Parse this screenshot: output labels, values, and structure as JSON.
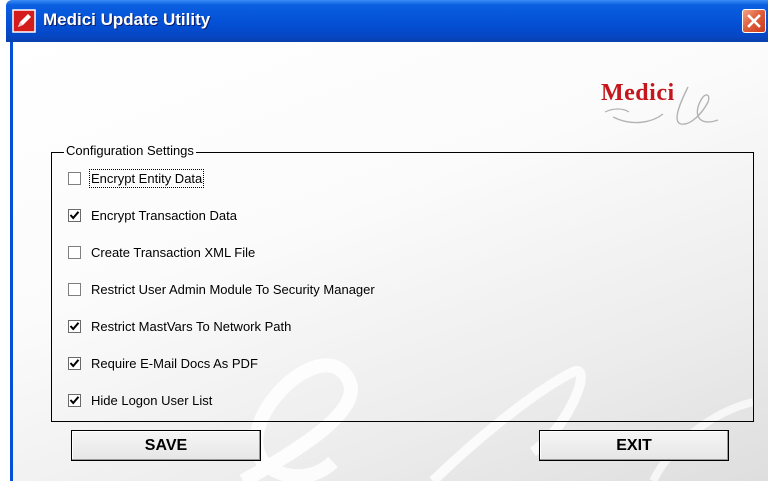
{
  "window": {
    "title": "Medici Update Utility",
    "accent_color": "#0450d6",
    "close_icon": "close-x-icon",
    "app_icon": "edit-pencil-icon"
  },
  "logo": {
    "text": "Medici",
    "color": "#c4161c"
  },
  "settings": {
    "group_title": "Configuration Settings",
    "options": [
      {
        "label": "Encrypt Entity Data",
        "checked": false,
        "focused": true
      },
      {
        "label": "Encrypt Transaction Data",
        "checked": true
      },
      {
        "label": "Create Transaction XML File",
        "checked": false
      },
      {
        "label": "Restrict User Admin Module To Security Manager",
        "checked": false
      },
      {
        "label": "Restrict MastVars To Network Path",
        "checked": true
      },
      {
        "label": "Require E-Mail Docs As PDF",
        "checked": true
      },
      {
        "label": "Hide Logon User List",
        "checked": true
      }
    ]
  },
  "buttons": {
    "save": "SAVE",
    "exit": "EXIT"
  }
}
